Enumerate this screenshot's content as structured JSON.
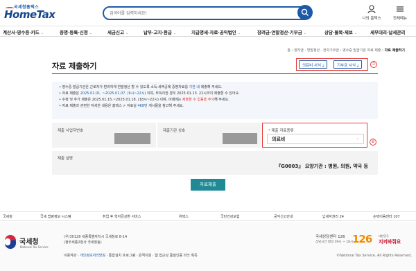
{
  "header": {
    "logo_small": "국세청홈택스",
    "logo_big": "HomeTax",
    "search_placeholder": "검색어를 입력하세요!",
    "util": [
      {
        "label": "나의 홈택스"
      },
      {
        "label": "전체메뉴"
      }
    ]
  },
  "nav": {
    "items": [
      {
        "label": "계산서·영수증·카드"
      },
      {
        "label": "증명·등록·신청"
      },
      {
        "label": "세금신고"
      },
      {
        "label": "납부·고지·환급"
      },
      {
        "label": "지급명세·자료·공익법인"
      },
      {
        "label": "장려금·연말정산·기부금"
      },
      {
        "label": "상담·불복·제보"
      },
      {
        "label": "세무대리·납세관리"
      }
    ]
  },
  "breadcrumb": {
    "path": "홈 › 장려금 · 연말정산 · 전자기부금 › 영수증 발급기관 자료 제출 ›",
    "current": "자료 제출하기"
  },
  "page": {
    "title": "자료 제출하기",
    "btn_medical": "의료비 서식",
    "btn_donation": "기부금 서식",
    "marker_7": "⑦",
    "marker_6": "⑥"
  },
  "notice": {
    "line1_a": "영수증 발급기관은 근로자가 편리하게 연말정산 할 수 있도록 소득·세액공제 증명자료를",
    "line1_b": "기한 내",
    "line1_c": "제출해 주세요.",
    "line2_a": "자료 제출은",
    "line2_b": "2025.01.01. ~2025.01.07. (6시~22시)",
    "line2_c": "이며, 부득이한 경우 2025.01.13. 22시까지 제출할 수 있어요.",
    "line3_a": "수정 및 추가 제출은 2025.01.15.~2025.01.18. (18시~22시) 이며, 이때에는",
    "line3_b": "제출할 수 없음을 주의",
    "line3_c": "해 주세요.",
    "line4_a": "자료 제출과 관련한 자세한 내용은 홈택스 > 자료실",
    "line4_b": "468번",
    "line4_c": "게시물을 참고해 주세요."
  },
  "form": {
    "bizno_label": "제출 사업자번호",
    "org_label": "제출기관 상호",
    "type_label_req": "*",
    "type_label": "제출 자료종류",
    "type_value": "의료비",
    "desc_label": "제출 설명",
    "desc_value": "『G0003』 요양기관 : 병원, 의원, 약국 등",
    "submit": "자료제출"
  },
  "footer_links": [
    "국세청",
    "국세 법령정보 시스템",
    "취업 후 학자금상환 서비스",
    "위택스",
    "국민건강보험",
    "공익신고안내",
    "납세자권리 24",
    "손택이음센터 107"
  ],
  "footer": {
    "org": "국세청",
    "org_sub": "National Tax Service",
    "addr1": "(우)30128 세종특별자치시 국세청로 8-14",
    "addr2": "(정부세종2청사 국세청동)",
    "menu": [
      "이용약관",
      "개인정보처리방침",
      "통합설치 프로그램",
      "원격지원",
      "웹 접근성 품질인증 마크 획득"
    ],
    "center_name": "국세상담센터 126",
    "center_hours": "상담시간 평일 09시 ~ 18시",
    "num": "126",
    "jikim_top": "대한민국",
    "jikim": "지켜봐줘요",
    "copyright": "©National Tax Service. All Rights Reserved."
  }
}
